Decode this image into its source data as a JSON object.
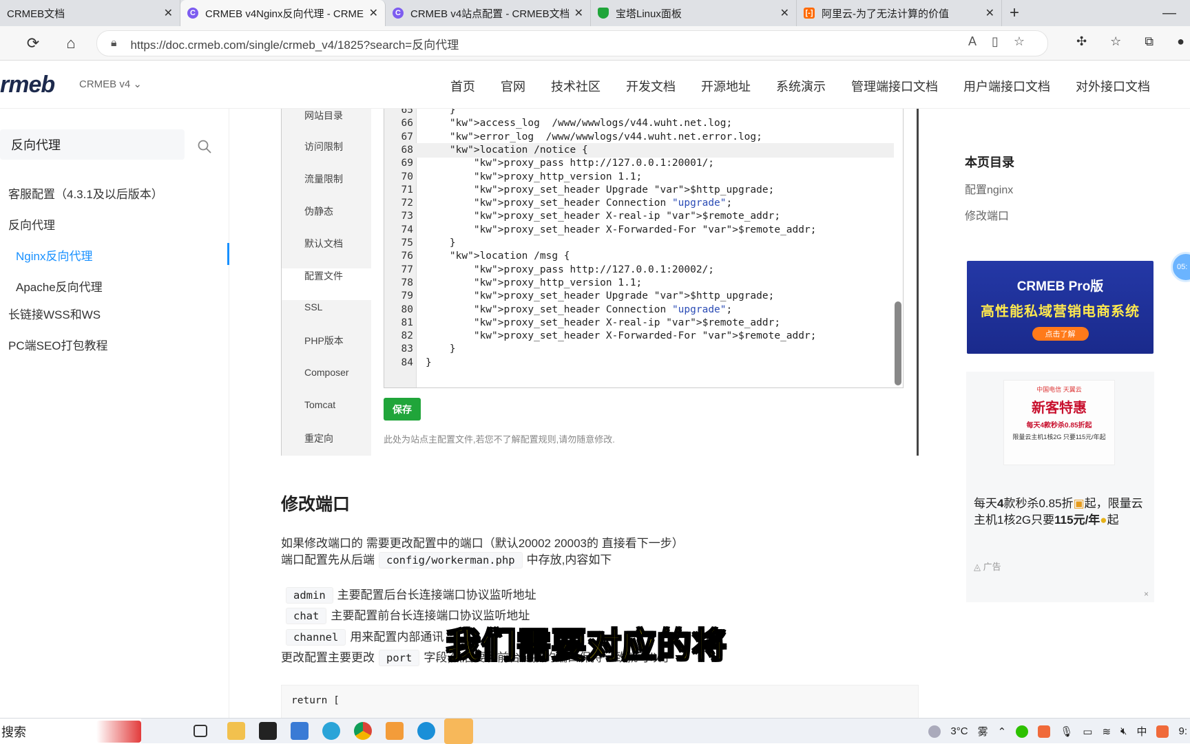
{
  "browser": {
    "tabs": [
      {
        "title": "CRMEB文档",
        "icon": "crmeb-icon",
        "active": false
      },
      {
        "title": "CRMEB v4Nginx反向代理 - CRME",
        "icon": "crmeb-icon",
        "active": true
      },
      {
        "title": "CRMEB v4站点配置 - CRMEB文档",
        "icon": "crmeb-icon",
        "active": false
      },
      {
        "title": "宝塔Linux面板",
        "icon": "bt-shield-icon",
        "active": false
      },
      {
        "title": "阿里云-为了无法计算的价值",
        "icon": "aliyun-icon",
        "active": false
      }
    ],
    "new_tab": "+",
    "minimize": "—",
    "url": "https://doc.crmeb.com/single/crmeb_v4/1825?search=反向代理"
  },
  "site": {
    "logo": "rmeb",
    "version": "CRMEB v4",
    "nav": [
      "首页",
      "官网",
      "技术社区",
      "开发文档",
      "开源地址",
      "系统演示",
      "管理端接口文档",
      "用户端接口文档",
      "对外接口文档"
    ]
  },
  "sidebar": {
    "search_value": "反向代理",
    "items": [
      {
        "label": "客服配置（4.3.1及以后版本）",
        "sub": false,
        "active": false
      },
      {
        "label": "反向代理",
        "sub": false,
        "active": false
      },
      {
        "label": "Nginx反向代理",
        "sub": true,
        "active": true
      },
      {
        "label": "Apache反向代理",
        "sub": true,
        "active": false
      },
      {
        "label": "长链接WSS和WS",
        "sub": false,
        "active": false
      },
      {
        "label": "PC端SEO打包教程",
        "sub": false,
        "active": false
      }
    ]
  },
  "screenshot": {
    "menu": [
      "网站目录",
      "访问限制",
      "流量限制",
      "伪静态",
      "默认文档",
      "配置文件",
      "SSL",
      "PHP版本",
      "Composer",
      "Tomcat",
      "重定向"
    ],
    "selected_menu": "配置文件",
    "save_label": "保存",
    "note": "此处为站点主配置文件,若您不了解配置规则,请勿随意修改.",
    "lines": [
      {
        "n": "65",
        "code": "    }"
      },
      {
        "n": "66",
        "code": "    access_log  /www/wwwlogs/v44.wuht.net.log;"
      },
      {
        "n": "67",
        "code": "    error_log  /www/wwwlogs/v44.wuht.net.error.log;"
      },
      {
        "n": "68",
        "code": "    location /notice {"
      },
      {
        "n": "69",
        "code": "        proxy_pass http://127.0.0.1:20001/;"
      },
      {
        "n": "70",
        "code": "        proxy_http_version 1.1;"
      },
      {
        "n": "71",
        "code": "        proxy_set_header Upgrade $http_upgrade;"
      },
      {
        "n": "72",
        "code": "        proxy_set_header Connection \"upgrade\";"
      },
      {
        "n": "73",
        "code": "        proxy_set_header X-real-ip $remote_addr;"
      },
      {
        "n": "74",
        "code": "        proxy_set_header X-Forwarded-For $remote_addr;"
      },
      {
        "n": "75",
        "code": "    }"
      },
      {
        "n": "76",
        "code": "    location /msg {"
      },
      {
        "n": "77",
        "code": "        proxy_pass http://127.0.0.1:20002/;"
      },
      {
        "n": "78",
        "code": "        proxy_http_version 1.1;"
      },
      {
        "n": "79",
        "code": "        proxy_set_header Upgrade $http_upgrade;"
      },
      {
        "n": "80",
        "code": "        proxy_set_header Connection \"upgrade\";"
      },
      {
        "n": "81",
        "code": "        proxy_set_header X-real-ip $remote_addr;"
      },
      {
        "n": "82",
        "code": "        proxy_set_header X-Forwarded-For $remote_addr;"
      },
      {
        "n": "83",
        "code": "    }"
      },
      {
        "n": "84",
        "code": "}"
      }
    ]
  },
  "content": {
    "section_title": "修改端口",
    "p1": "如果修改端口的 需要更改配置中的端口（默认20002 20003的 直接看下一步）",
    "p2_before": "端口配置先从后端",
    "p2_code": "config/workerman.php",
    "p2_after": "中存放,内容如下",
    "items": [
      {
        "code": "admin",
        "text": "主要配置后台长连接端口协议监听地址"
      },
      {
        "code": "chat",
        "text": "主要配置前台长连接端口协议监听地址"
      },
      {
        "code": "channel",
        "text": "用来配置内部通讯"
      }
    ],
    "p3_before": "更改配置主要更改",
    "p3_code": "port",
    "p3_after": "字段,然后要和前台链接的端口保持一致就可以了",
    "codeblock": "return ["
  },
  "toc": {
    "title": "本页目录",
    "items": [
      "配置nginx",
      "修改端口"
    ]
  },
  "ads": {
    "ad1_title": "CRMEB Pro版",
    "ad1_slogan": "高性能私域营销电商系统",
    "ad1_button": "点击了解",
    "ad2_header": "中国电信 天翼云",
    "ad2_big": "新客特惠",
    "ad2_line1": "每天4款秒杀0.85折起",
    "ad2_line2": "限量云主机1核2G 只要115元/年起",
    "ad2_text_a": "每天",
    "ad2_text_b": "4",
    "ad2_text_c": "款秒杀0.85折",
    "ad2_text_d": "起，限量云主机1核2G只要",
    "ad2_text_e": "115元/年",
    "ad2_text_f": "起",
    "ad_label": "广告",
    "ad_close": "×",
    "float_bubble": "05:"
  },
  "subtitle": "我们需要对应的将",
  "taskbar": {
    "search": "搜索",
    "weather": "3°C",
    "weather_desc": "雾",
    "ime": "中",
    "clock": "9:"
  },
  "colors": {
    "accent": "#1890ff",
    "save_green": "#20a53a",
    "subtitle_yellow": "#ffe600"
  }
}
